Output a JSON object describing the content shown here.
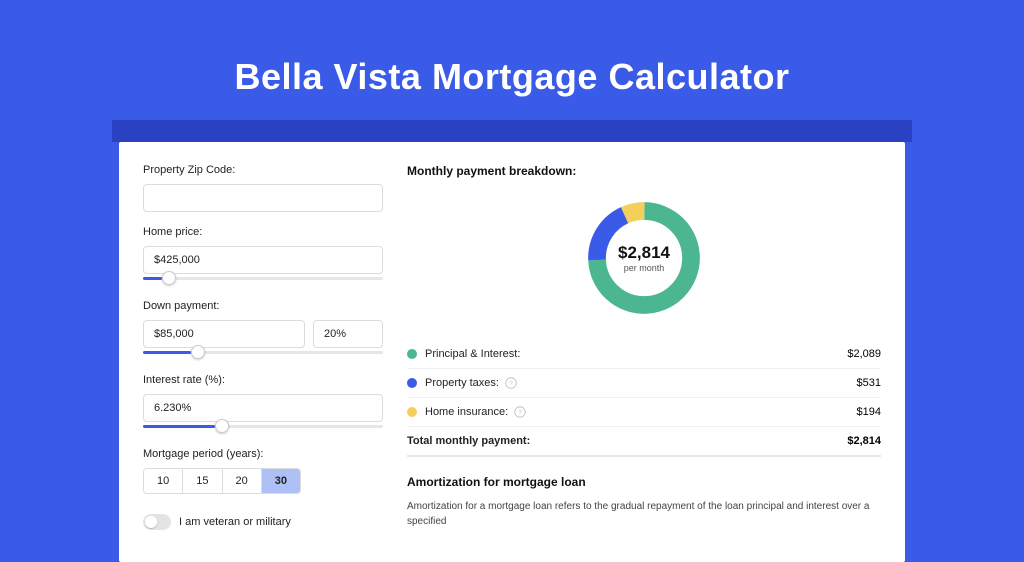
{
  "title": "Bella Vista Mortgage Calculator",
  "form": {
    "zip_label": "Property Zip Code:",
    "zip_value": "",
    "home_price_label": "Home price:",
    "home_price_value": "$425,000",
    "down_payment_label": "Down payment:",
    "down_payment_value": "$85,000",
    "down_payment_pct": "20%",
    "interest_label": "Interest rate (%):",
    "interest_value": "6.230%",
    "period_label": "Mortgage period (years):",
    "period_options": [
      "10",
      "15",
      "20",
      "30"
    ],
    "period_selected": "30",
    "veteran_label": "I am veteran or military"
  },
  "breakdown": {
    "title": "Monthly payment breakdown:",
    "total_amount": "$2,814",
    "per_month": "per month",
    "items": [
      {
        "label": "Principal & Interest:",
        "value": "$2,089",
        "color": "#4bb68f",
        "info": false
      },
      {
        "label": "Property taxes:",
        "value": "$531",
        "color": "#3a5ae8",
        "info": true
      },
      {
        "label": "Home insurance:",
        "value": "$194",
        "color": "#f4cf5c",
        "info": true
      }
    ],
    "total_label": "Total monthly payment:",
    "total_value": "$2,814"
  },
  "amortization": {
    "title": "Amortization for mortgage loan",
    "body": "Amortization for a mortgage loan refers to the gradual repayment of the loan principal and interest over a specified"
  },
  "chart_data": {
    "type": "pie",
    "title": "Monthly payment breakdown",
    "categories": [
      "Principal & Interest",
      "Property taxes",
      "Home insurance"
    ],
    "values": [
      2089,
      531,
      194
    ],
    "colors": [
      "#4bb68f",
      "#3a5ae8",
      "#f4cf5c"
    ],
    "center_label": "$2,814 per month"
  }
}
